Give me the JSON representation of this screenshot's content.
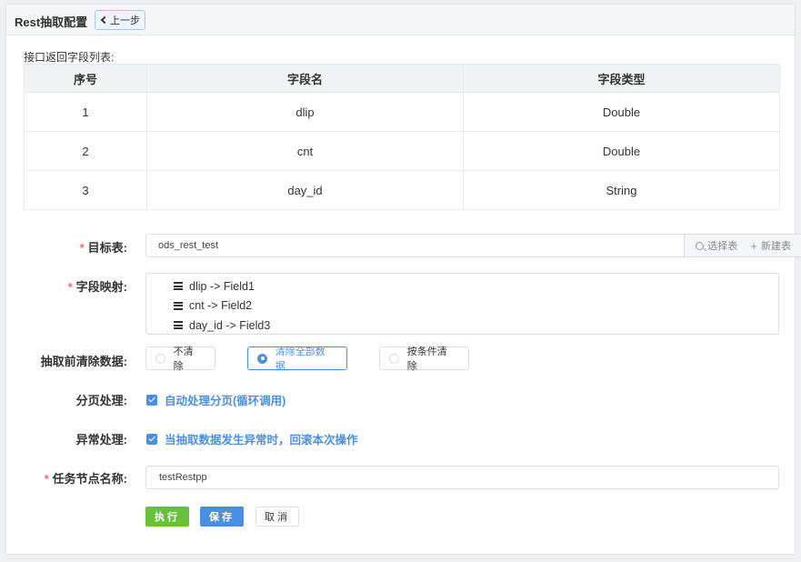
{
  "header": {
    "title": "Rest抽取配置",
    "back_label": "上一步"
  },
  "fields_table": {
    "caption": "接口返回字段列表:",
    "columns": [
      "序号",
      "字段名",
      "字段类型"
    ],
    "rows": [
      [
        "1",
        "dlip",
        "Double"
      ],
      [
        "2",
        "cnt",
        "Double"
      ],
      [
        "3",
        "day_id",
        "String"
      ]
    ]
  },
  "form": {
    "target_table": {
      "label": "目标表:",
      "required": "*",
      "value": "ods_rest_test",
      "select_label": "选择表",
      "create_label": "新建表"
    },
    "field_mapping": {
      "label": "字段映射:",
      "required": "*",
      "items": [
        "dlip -> Field1",
        "cnt -> Field2",
        "day_id -> Field3"
      ]
    },
    "pre_clean": {
      "label": "抽取前清除数据:",
      "options": [
        "不清除",
        "清除全部数据",
        "按条件清除"
      ],
      "selected": "清除全部数据"
    },
    "paging": {
      "label": "分页处理:",
      "checkbox_label": "自动处理分页(循环调用)",
      "checked": true
    },
    "exception": {
      "label": "异常处理:",
      "checkbox_label": "当抽取数据发生异常时，回滚本次操作",
      "checked": true
    },
    "task_name": {
      "label": "任务节点名称:",
      "required": "*",
      "value": "testRestpp"
    }
  },
  "actions": {
    "run": "执行",
    "save": "保存",
    "cancel": "取消"
  },
  "colors": {
    "primary": "#4a90e2",
    "success": "#67c23a",
    "required": "#f56c6c"
  }
}
